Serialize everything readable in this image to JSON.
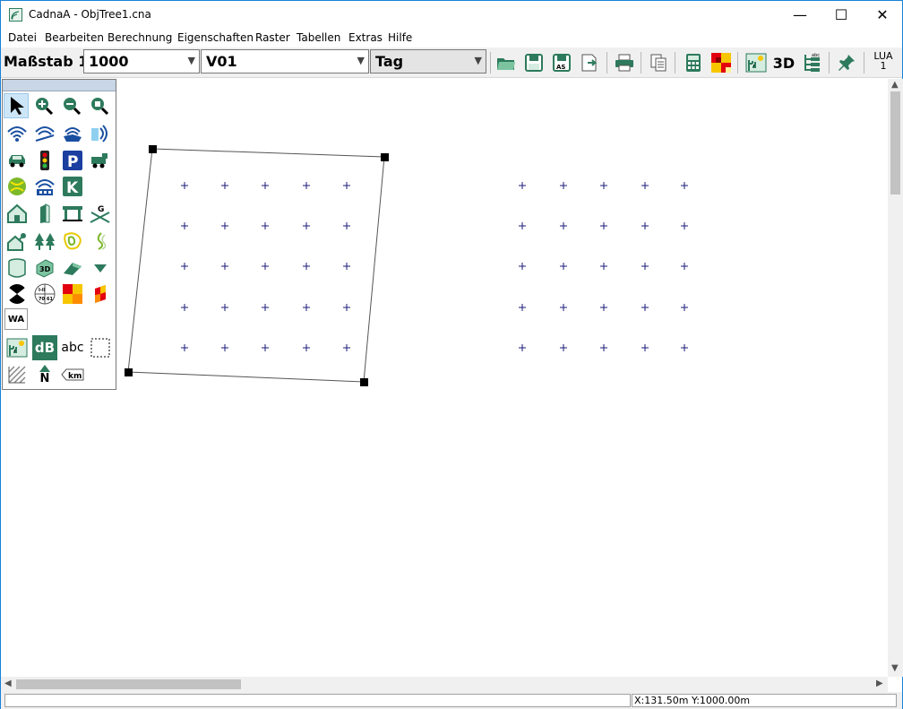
{
  "window": {
    "title": "CadnaA - ObjTree1.cna",
    "minimize": "—",
    "maximize": "☐",
    "close": "✕"
  },
  "menu": [
    "Datei",
    "Bearbeiten",
    "Berechnung",
    "Eigenschaften",
    "Raster",
    "Tabellen",
    "Extras",
    "Hilfe"
  ],
  "toolbar": {
    "scale_label": "Maßstab 1:",
    "scale_value": "1000",
    "variant_value": "V01",
    "period_value": "Tag",
    "label_3d": "3D",
    "lua_label": "LUA",
    "lua_value": "1"
  },
  "palette": {
    "wa_label": "WA",
    "db_label": "dB",
    "abc_label": "abc",
    "km_label": "km",
    "north_label": "N"
  },
  "status": {
    "left": "",
    "coords": "X:131.50m Y:1000.00m"
  },
  "colors": {
    "accent": "#1883d7",
    "grid_point": "#1a1a7a",
    "tool_green": "#2d7a5c",
    "palette_title": "#c8d6e6"
  },
  "icons": [
    "open-folder-icon",
    "save-icon",
    "save-as-icon",
    "export-icon",
    "print-icon",
    "copy-icon",
    "calculator-icon",
    "grid-map-icon",
    "object-tree-icon",
    "3d-view-icon",
    "text-tree-icon",
    "pin-icon"
  ]
}
